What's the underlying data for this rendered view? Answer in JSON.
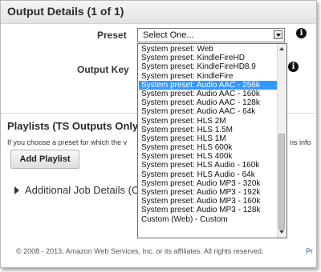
{
  "section": {
    "title": "Output Details (1 of 1)"
  },
  "preset": {
    "label": "Preset",
    "selected": "Select One..."
  },
  "output_key": {
    "label": "Output Key"
  },
  "info_icon": "i",
  "playlists": {
    "title": "Playlists (TS Outputs Only",
    "help": "If you choose a preset for which the v",
    "help_tail": "ns info",
    "add_button": "Add Playlist"
  },
  "additional": {
    "label": "Additional Job Details (O"
  },
  "footer": {
    "copyright": "© 2008 - 2013, Amazon Web Services, Inc. or its affiliates. All rights reserved.",
    "link": "Pr"
  },
  "dropdown": {
    "selected_index": 4,
    "options": [
      "System preset: Web",
      "System preset: KindleFireHD",
      "System preset: KindleFireHD8.9",
      "System preset: KindleFire",
      "System preset: Audio AAC - 256k",
      "System preset: Audio AAC - 160k",
      "System preset: Audio AAC - 128k",
      "System preset: Audio AAC - 64k",
      "System preset: HLS 2M",
      "System preset: HLS 1.5M",
      "System preset: HLS 1M",
      "System preset: HLS 600k",
      "System preset: HLS 400k",
      "System preset: HLS Audio - 160k",
      "System preset: HLS Audio - 64k",
      "System preset: Audio MP3 - 320k",
      "System preset: Audio MP3 - 192k",
      "System preset: Audio MP3 - 160k",
      "System preset: Audio MP3 - 128k",
      "Custom (Web) - Custom"
    ]
  }
}
